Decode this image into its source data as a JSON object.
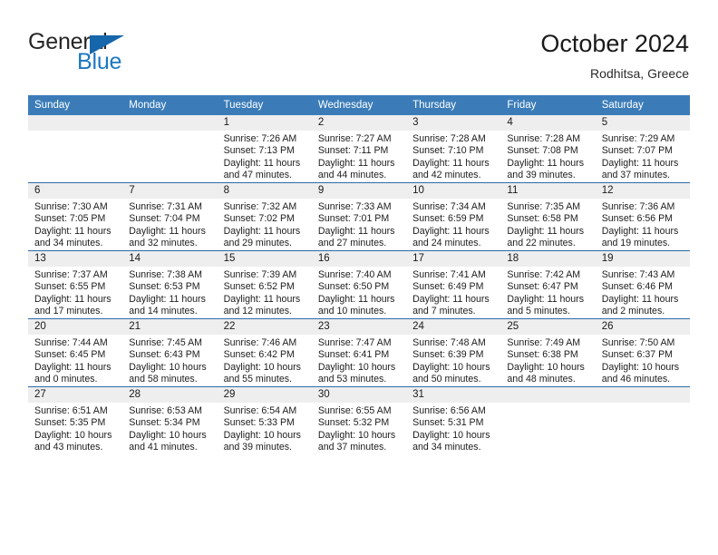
{
  "brand": {
    "name_top": "General",
    "name_bottom": "Blue",
    "triangle_icon": "triangle-icon",
    "accent_color": "#1b78c2"
  },
  "header": {
    "title": "October 2024",
    "subtitle": "Rodhitsa, Greece"
  },
  "theme": {
    "header_bg": "#3b7cb8",
    "row_divider": "#2c6ca8",
    "daynum_band": "#eeeeee"
  },
  "weekday_headers": [
    "Sunday",
    "Monday",
    "Tuesday",
    "Wednesday",
    "Thursday",
    "Friday",
    "Saturday"
  ],
  "weeks": [
    [
      {
        "day": "",
        "lines": []
      },
      {
        "day": "",
        "lines": []
      },
      {
        "day": "1",
        "lines": [
          "Sunrise: 7:26 AM",
          "Sunset: 7:13 PM",
          "Daylight: 11 hours",
          "and 47 minutes."
        ]
      },
      {
        "day": "2",
        "lines": [
          "Sunrise: 7:27 AM",
          "Sunset: 7:11 PM",
          "Daylight: 11 hours",
          "and 44 minutes."
        ]
      },
      {
        "day": "3",
        "lines": [
          "Sunrise: 7:28 AM",
          "Sunset: 7:10 PM",
          "Daylight: 11 hours",
          "and 42 minutes."
        ]
      },
      {
        "day": "4",
        "lines": [
          "Sunrise: 7:28 AM",
          "Sunset: 7:08 PM",
          "Daylight: 11 hours",
          "and 39 minutes."
        ]
      },
      {
        "day": "5",
        "lines": [
          "Sunrise: 7:29 AM",
          "Sunset: 7:07 PM",
          "Daylight: 11 hours",
          "and 37 minutes."
        ]
      }
    ],
    [
      {
        "day": "6",
        "lines": [
          "Sunrise: 7:30 AM",
          "Sunset: 7:05 PM",
          "Daylight: 11 hours",
          "and 34 minutes."
        ]
      },
      {
        "day": "7",
        "lines": [
          "Sunrise: 7:31 AM",
          "Sunset: 7:04 PM",
          "Daylight: 11 hours",
          "and 32 minutes."
        ]
      },
      {
        "day": "8",
        "lines": [
          "Sunrise: 7:32 AM",
          "Sunset: 7:02 PM",
          "Daylight: 11 hours",
          "and 29 minutes."
        ]
      },
      {
        "day": "9",
        "lines": [
          "Sunrise: 7:33 AM",
          "Sunset: 7:01 PM",
          "Daylight: 11 hours",
          "and 27 minutes."
        ]
      },
      {
        "day": "10",
        "lines": [
          "Sunrise: 7:34 AM",
          "Sunset: 6:59 PM",
          "Daylight: 11 hours",
          "and 24 minutes."
        ]
      },
      {
        "day": "11",
        "lines": [
          "Sunrise: 7:35 AM",
          "Sunset: 6:58 PM",
          "Daylight: 11 hours",
          "and 22 minutes."
        ]
      },
      {
        "day": "12",
        "lines": [
          "Sunrise: 7:36 AM",
          "Sunset: 6:56 PM",
          "Daylight: 11 hours",
          "and 19 minutes."
        ]
      }
    ],
    [
      {
        "day": "13",
        "lines": [
          "Sunrise: 7:37 AM",
          "Sunset: 6:55 PM",
          "Daylight: 11 hours",
          "and 17 minutes."
        ]
      },
      {
        "day": "14",
        "lines": [
          "Sunrise: 7:38 AM",
          "Sunset: 6:53 PM",
          "Daylight: 11 hours",
          "and 14 minutes."
        ]
      },
      {
        "day": "15",
        "lines": [
          "Sunrise: 7:39 AM",
          "Sunset: 6:52 PM",
          "Daylight: 11 hours",
          "and 12 minutes."
        ]
      },
      {
        "day": "16",
        "lines": [
          "Sunrise: 7:40 AM",
          "Sunset: 6:50 PM",
          "Daylight: 11 hours",
          "and 10 minutes."
        ]
      },
      {
        "day": "17",
        "lines": [
          "Sunrise: 7:41 AM",
          "Sunset: 6:49 PM",
          "Daylight: 11 hours",
          "and 7 minutes."
        ]
      },
      {
        "day": "18",
        "lines": [
          "Sunrise: 7:42 AM",
          "Sunset: 6:47 PM",
          "Daylight: 11 hours",
          "and 5 minutes."
        ]
      },
      {
        "day": "19",
        "lines": [
          "Sunrise: 7:43 AM",
          "Sunset: 6:46 PM",
          "Daylight: 11 hours",
          "and 2 minutes."
        ]
      }
    ],
    [
      {
        "day": "20",
        "lines": [
          "Sunrise: 7:44 AM",
          "Sunset: 6:45 PM",
          "Daylight: 11 hours",
          "and 0 minutes."
        ]
      },
      {
        "day": "21",
        "lines": [
          "Sunrise: 7:45 AM",
          "Sunset: 6:43 PM",
          "Daylight: 10 hours",
          "and 58 minutes."
        ]
      },
      {
        "day": "22",
        "lines": [
          "Sunrise: 7:46 AM",
          "Sunset: 6:42 PM",
          "Daylight: 10 hours",
          "and 55 minutes."
        ]
      },
      {
        "day": "23",
        "lines": [
          "Sunrise: 7:47 AM",
          "Sunset: 6:41 PM",
          "Daylight: 10 hours",
          "and 53 minutes."
        ]
      },
      {
        "day": "24",
        "lines": [
          "Sunrise: 7:48 AM",
          "Sunset: 6:39 PM",
          "Daylight: 10 hours",
          "and 50 minutes."
        ]
      },
      {
        "day": "25",
        "lines": [
          "Sunrise: 7:49 AM",
          "Sunset: 6:38 PM",
          "Daylight: 10 hours",
          "and 48 minutes."
        ]
      },
      {
        "day": "26",
        "lines": [
          "Sunrise: 7:50 AM",
          "Sunset: 6:37 PM",
          "Daylight: 10 hours",
          "and 46 minutes."
        ]
      }
    ],
    [
      {
        "day": "27",
        "lines": [
          "Sunrise: 6:51 AM",
          "Sunset: 5:35 PM",
          "Daylight: 10 hours",
          "and 43 minutes."
        ]
      },
      {
        "day": "28",
        "lines": [
          "Sunrise: 6:53 AM",
          "Sunset: 5:34 PM",
          "Daylight: 10 hours",
          "and 41 minutes."
        ]
      },
      {
        "day": "29",
        "lines": [
          "Sunrise: 6:54 AM",
          "Sunset: 5:33 PM",
          "Daylight: 10 hours",
          "and 39 minutes."
        ]
      },
      {
        "day": "30",
        "lines": [
          "Sunrise: 6:55 AM",
          "Sunset: 5:32 PM",
          "Daylight: 10 hours",
          "and 37 minutes."
        ]
      },
      {
        "day": "31",
        "lines": [
          "Sunrise: 6:56 AM",
          "Sunset: 5:31 PM",
          "Daylight: 10 hours",
          "and 34 minutes."
        ]
      },
      {
        "day": "",
        "lines": []
      },
      {
        "day": "",
        "lines": []
      }
    ]
  ]
}
